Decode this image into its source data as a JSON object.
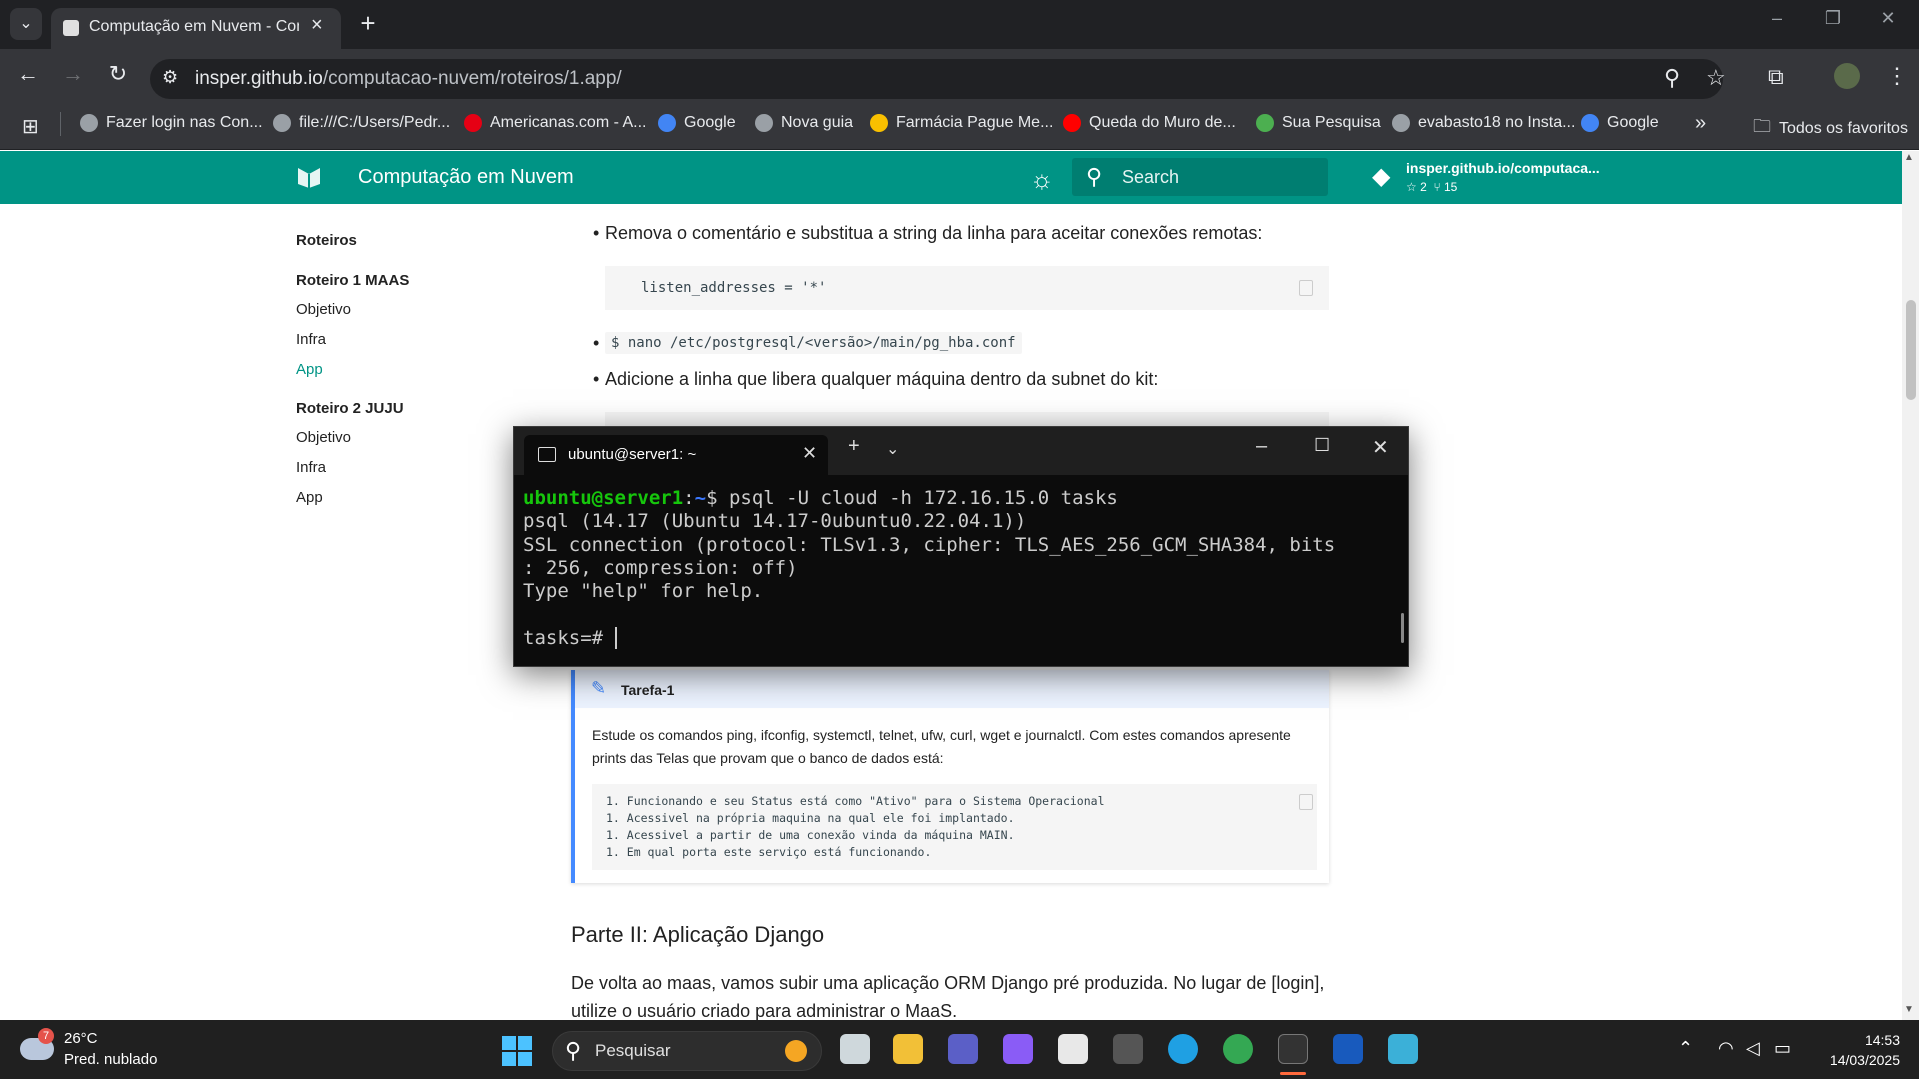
{
  "browser": {
    "tab_title": "Computação em Nuvem - Computação em Nuvem",
    "url_host": "insper.github.io",
    "url_path": "/computacao-nuvem/roteiros/1.app/",
    "bookmarks": [
      {
        "label": "Fazer login nas Con...",
        "color": "#9aa0a6"
      },
      {
        "label": "file:///C:/Users/Pedr...",
        "color": "#9aa0a6"
      },
      {
        "label": "Americanas.com - A...",
        "color": "#e60014"
      },
      {
        "label": "Google",
        "color": "#4285f4"
      },
      {
        "label": "Nova guia",
        "color": "#9aa0a6"
      },
      {
        "label": "Farmácia Pague Me...",
        "color": "#f9c000"
      },
      {
        "label": "Queda do Muro de...",
        "color": "#ff0000"
      },
      {
        "label": "Sua Pesquisa",
        "color": "#4caf50"
      },
      {
        "label": "evabasto18 no Insta...",
        "color": "#9aa0a6"
      },
      {
        "label": "Google",
        "color": "#4285f4"
      }
    ],
    "all_bookmarks": "Todos os favoritos"
  },
  "site": {
    "title": "Computação em Nuvem",
    "search_placeholder": "Search",
    "repo_name": "insper.github.io/computaca...",
    "repo_stars": "☆ 2",
    "repo_forks": "⑂ 15",
    "accent": "#009485"
  },
  "nav": {
    "section": "Roteiros",
    "r1_title": "Roteiro 1 MAAS",
    "r1_items": [
      "Objetivo",
      "Infra",
      "App"
    ],
    "r2_title": "Roteiro 2 JUJU",
    "r2_items": [
      "Objetivo",
      "Infra",
      "App"
    ]
  },
  "content": {
    "bullet1": "Remova o comentário e substitua a string da linha para aceitar conexões remotas:",
    "code1": "listen_addresses = '*'",
    "bullet2_code": "$ nano /etc/postgresql/<versão>/main/pg_hba.conf",
    "bullet3": "Adicione a linha que libera qualquer máquina dentro da subnet do kit:",
    "task_title": "Tarefa-1",
    "task_text": "Estude os comandos ping, ifconfig, systemctl, telnet, ufw, curl, wget e journalctl. Com estes comandos apresente prints das Telas que provam que o banco de dados está:",
    "task_list": [
      "1. Funcionando e seu Status está como \"Ativo\" para o Sistema Operacional",
      "1. Acessivel na própria maquina na qual ele foi implantado.",
      "1. Acessivel a partir de uma conexão vinda da máquina MAIN.",
      "1. Em qual porta este serviço está funcionando."
    ],
    "h2": "Parte II: Aplicação Django",
    "para1": "De volta ao maas, vamos subir uma aplicação ORM Django pré produzida. No lugar de [login],",
    "para2": "utilize o usuário criado para administrar o MaaS."
  },
  "terminal": {
    "tab_title": "ubuntu@server1: ~",
    "prompt_user": "ubuntu@server1",
    "prompt_sep": ":",
    "prompt_path": "~",
    "prompt_end": "$ psql -U cloud -h 172.16.15.0 tasks",
    "line2": "psql (14.17 (Ubuntu 14.17-0ubuntu0.22.04.1))",
    "line3": "SSL connection (protocol: TLSv1.3, cipher: TLS_AES_256_GCM_SHA384, bits",
    "line4": ": 256, compression: off)",
    "line5": "Type \"help\" for help.",
    "line7": "tasks=# "
  },
  "taskbar": {
    "weather_temp": "26°C",
    "weather_desc": "Pred. nublado",
    "weather_badge": "7",
    "search_label": "Pesquisar",
    "time": "14:53",
    "date": "14/03/2025"
  }
}
